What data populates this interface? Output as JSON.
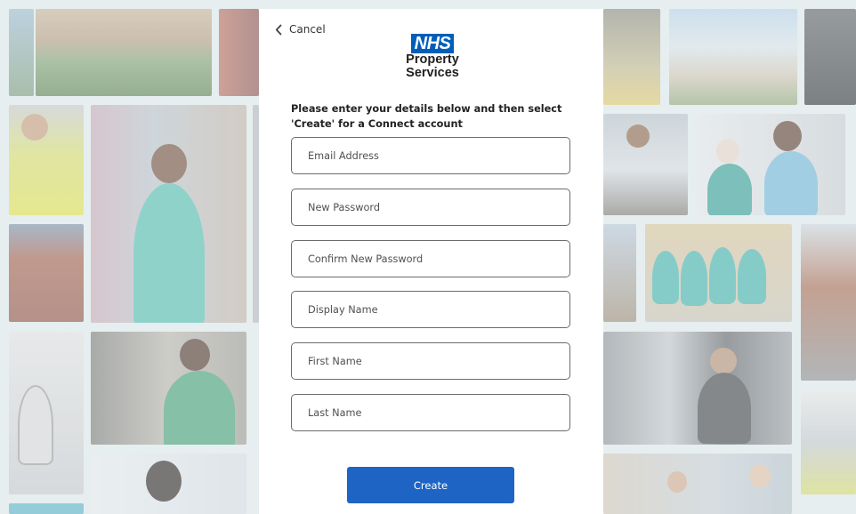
{
  "header": {
    "cancel_label": "Cancel",
    "logo": {
      "nhs": "NHS",
      "line1": "Property",
      "line2": "Services"
    }
  },
  "form": {
    "intro": "Please enter your details below and then select 'Create' for a Connect account",
    "fields": [
      {
        "placeholder": "Email Address",
        "value": ""
      },
      {
        "placeholder": "New Password",
        "value": ""
      },
      {
        "placeholder": "Confirm New Password",
        "value": ""
      },
      {
        "placeholder": "Display Name",
        "value": ""
      },
      {
        "placeholder": "First Name",
        "value": ""
      },
      {
        "placeholder": "Last Name",
        "value": ""
      }
    ],
    "submit_label": "Create"
  },
  "theme": {
    "accent": "#1d64c4",
    "nhs_blue": "#005eb8",
    "panel_background": "#ffffff",
    "page_background": "#e6eef0"
  },
  "icons": {
    "cancel": "chevron-left-icon"
  }
}
